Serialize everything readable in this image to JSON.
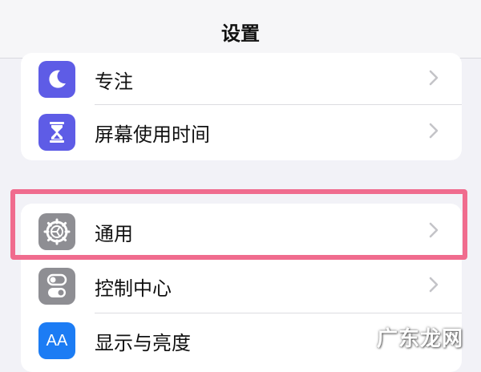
{
  "nav": {
    "title": "设置"
  },
  "rows": [
    {
      "label": "专注",
      "icon": "moon-icon",
      "icon_bg": "#5e5ce6"
    },
    {
      "label": "屏幕使用时间",
      "icon": "hourglass-icon",
      "icon_bg": "#5e5ce6"
    },
    {
      "label": "通用",
      "icon": "gear-icon",
      "icon_bg": "#8e8e93"
    },
    {
      "label": "控制中心",
      "icon": "toggle-icon",
      "icon_bg": "#8e8e93"
    },
    {
      "label": "显示与亮度",
      "icon": "text-size-icon",
      "icon_bg": "#1c7cf4",
      "icon_text": "AA"
    }
  ],
  "highlight_color": "#f06c8e",
  "watermark": "广东龙网"
}
